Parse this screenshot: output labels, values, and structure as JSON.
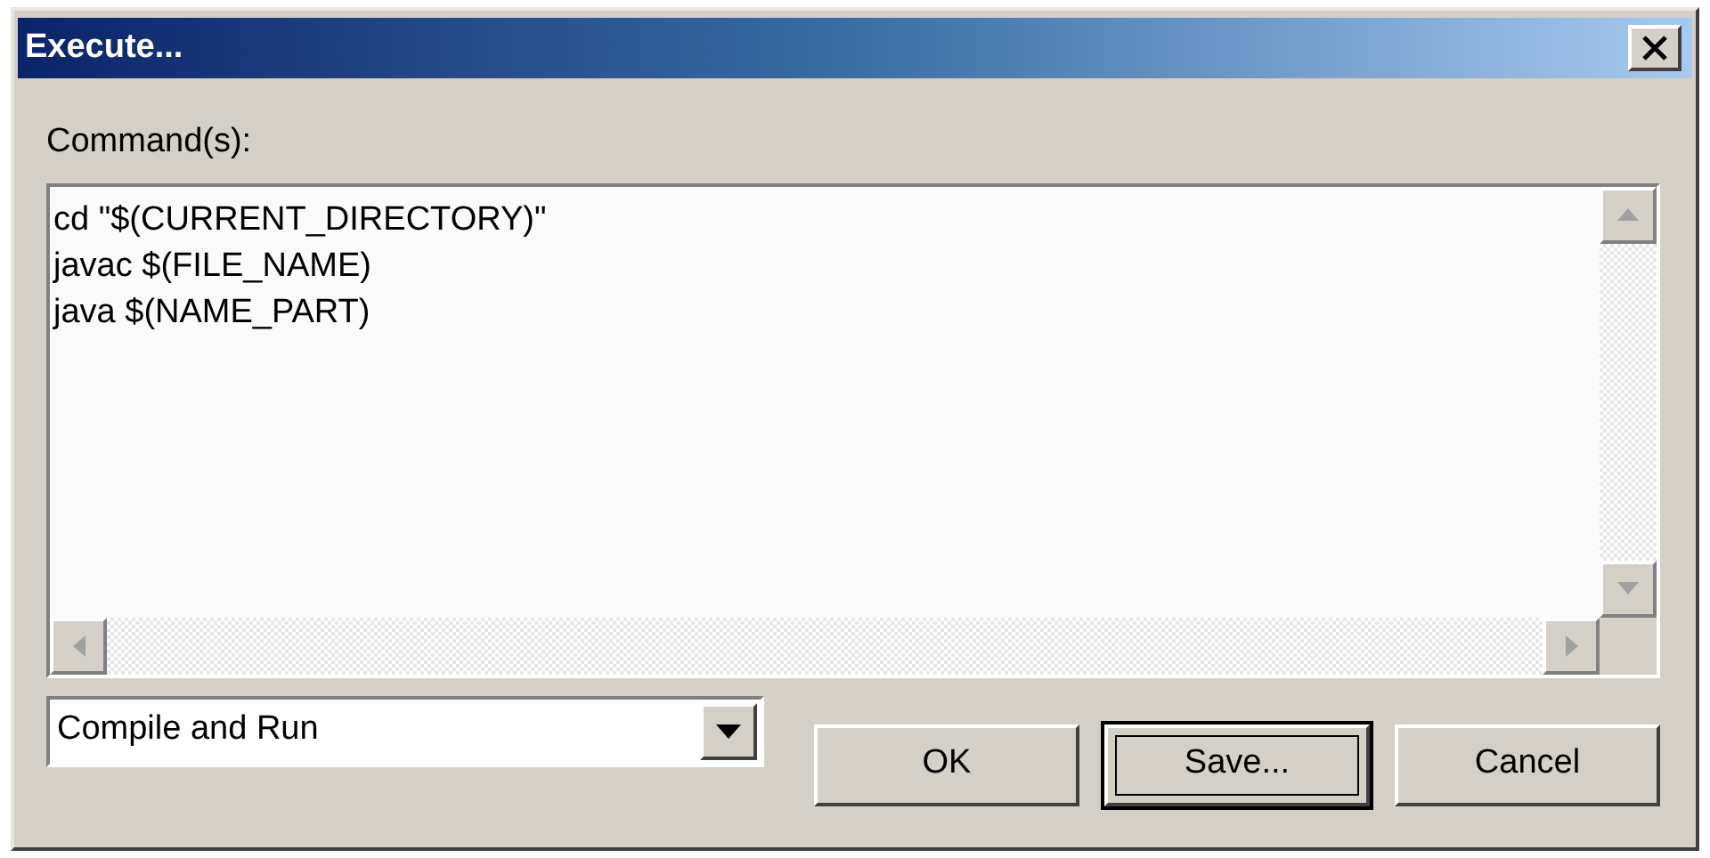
{
  "window": {
    "title": "Execute..."
  },
  "commands": {
    "label": "Command(s):",
    "lines": [
      "cd \"$(CURRENT_DIRECTORY)\"",
      "javac $(FILE_NAME)",
      "java $(NAME_PART)"
    ]
  },
  "preset": {
    "value": "Compile and Run"
  },
  "buttons": [
    {
      "label": "OK",
      "default": false
    },
    {
      "label": "Save...",
      "default": true
    },
    {
      "label": "Cancel",
      "default": false
    }
  ]
}
